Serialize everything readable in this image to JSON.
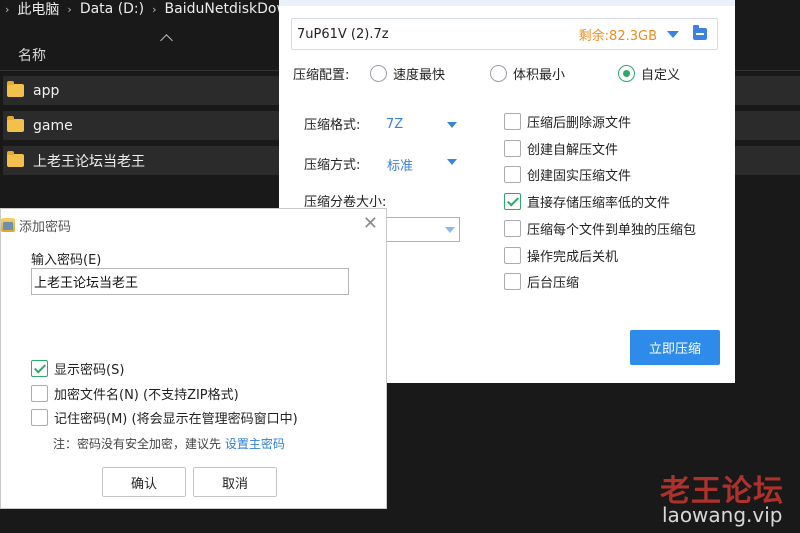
{
  "explorer": {
    "breadcrumb": [
      "此电脑",
      "Data (D:)",
      "BaiduNetdiskDow"
    ],
    "column_header": "名称",
    "items": [
      {
        "name": "app"
      },
      {
        "name": "game"
      },
      {
        "name": "上老王论坛当老王"
      }
    ]
  },
  "compress": {
    "filename": "7uP61V (2).7z",
    "free_space": "剩余:82.3GB",
    "config_label": "压缩配置:",
    "modes": [
      "速度最快",
      "体积最小",
      "自定义"
    ],
    "selected_mode": "自定义",
    "format_label": "压缩格式:",
    "format_value": "7Z",
    "method_label": "压缩方式:",
    "method_value": "标准",
    "split_label": "压缩分卷大小:",
    "options": [
      {
        "label": "压缩后删除源文件",
        "checked": false
      },
      {
        "label": "创建自解压文件",
        "checked": false
      },
      {
        "label": "创建固实压缩文件",
        "checked": false
      },
      {
        "label": "直接存储压缩率低的文件",
        "checked": true
      },
      {
        "label": "压缩每个文件到单独的压缩包",
        "checked": false
      },
      {
        "label": "操作完成后关机",
        "checked": false
      },
      {
        "label": "后台压缩",
        "checked": false
      }
    ],
    "start_button": "立即压缩",
    "accent_color": "#2f8bea",
    "free_color": "#f08c1a"
  },
  "password": {
    "title": "添加密码",
    "input_label": "输入密码(E)",
    "input_value": "上老王论坛当老王",
    "options": [
      {
        "label": "显示密码(S)",
        "checked": true
      },
      {
        "label": "加密文件名(N) (不支持ZIP格式)",
        "checked": false
      },
      {
        "label": "记住密码(M) (将会显示在管理密码窗口中)",
        "checked": false
      }
    ],
    "note": "注：密码没有安全加密，建议先",
    "note_link": "设置主密码",
    "ok": "确认",
    "cancel": "取消"
  },
  "watermark": {
    "title": "老王论坛",
    "url": "laowang.vip"
  }
}
